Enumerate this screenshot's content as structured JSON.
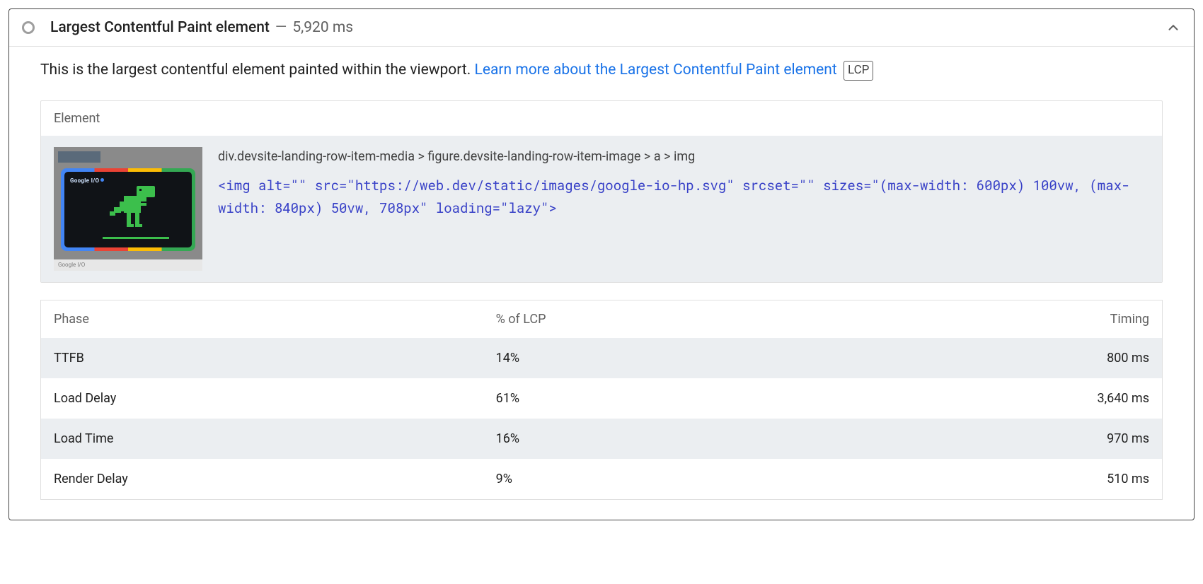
{
  "header": {
    "title": "Largest Contentful Paint element",
    "separator": "—",
    "timing": "5,920 ms"
  },
  "description": {
    "text": "This is the largest contentful element painted within the viewport. ",
    "link_text": "Learn more about the Largest Contentful Paint element",
    "badge": "LCP"
  },
  "element_panel": {
    "header": "Element",
    "selector": "div.devsite-landing-row-item-media > figure.devsite-landing-row-item-image > a > img",
    "snippet": "<img alt=\"\" src=\"https://web.dev/static/images/google-io-hp.svg\" srcset=\"\" sizes=\"(max-width: 600px) 100vw, (max-width: 840px) 50vw, 708px\" loading=\"lazy\">",
    "thumb_brand": "Google I/O",
    "thumb_footer": "Google I/O"
  },
  "phase_table": {
    "columns": [
      "Phase",
      "% of LCP",
      "Timing"
    ],
    "rows": [
      {
        "phase": "TTFB",
        "pct": "14%",
        "timing": "800 ms"
      },
      {
        "phase": "Load Delay",
        "pct": "61%",
        "timing": "3,640 ms"
      },
      {
        "phase": "Load Time",
        "pct": "16%",
        "timing": "970 ms"
      },
      {
        "phase": "Render Delay",
        "pct": "9%",
        "timing": "510 ms"
      }
    ]
  }
}
